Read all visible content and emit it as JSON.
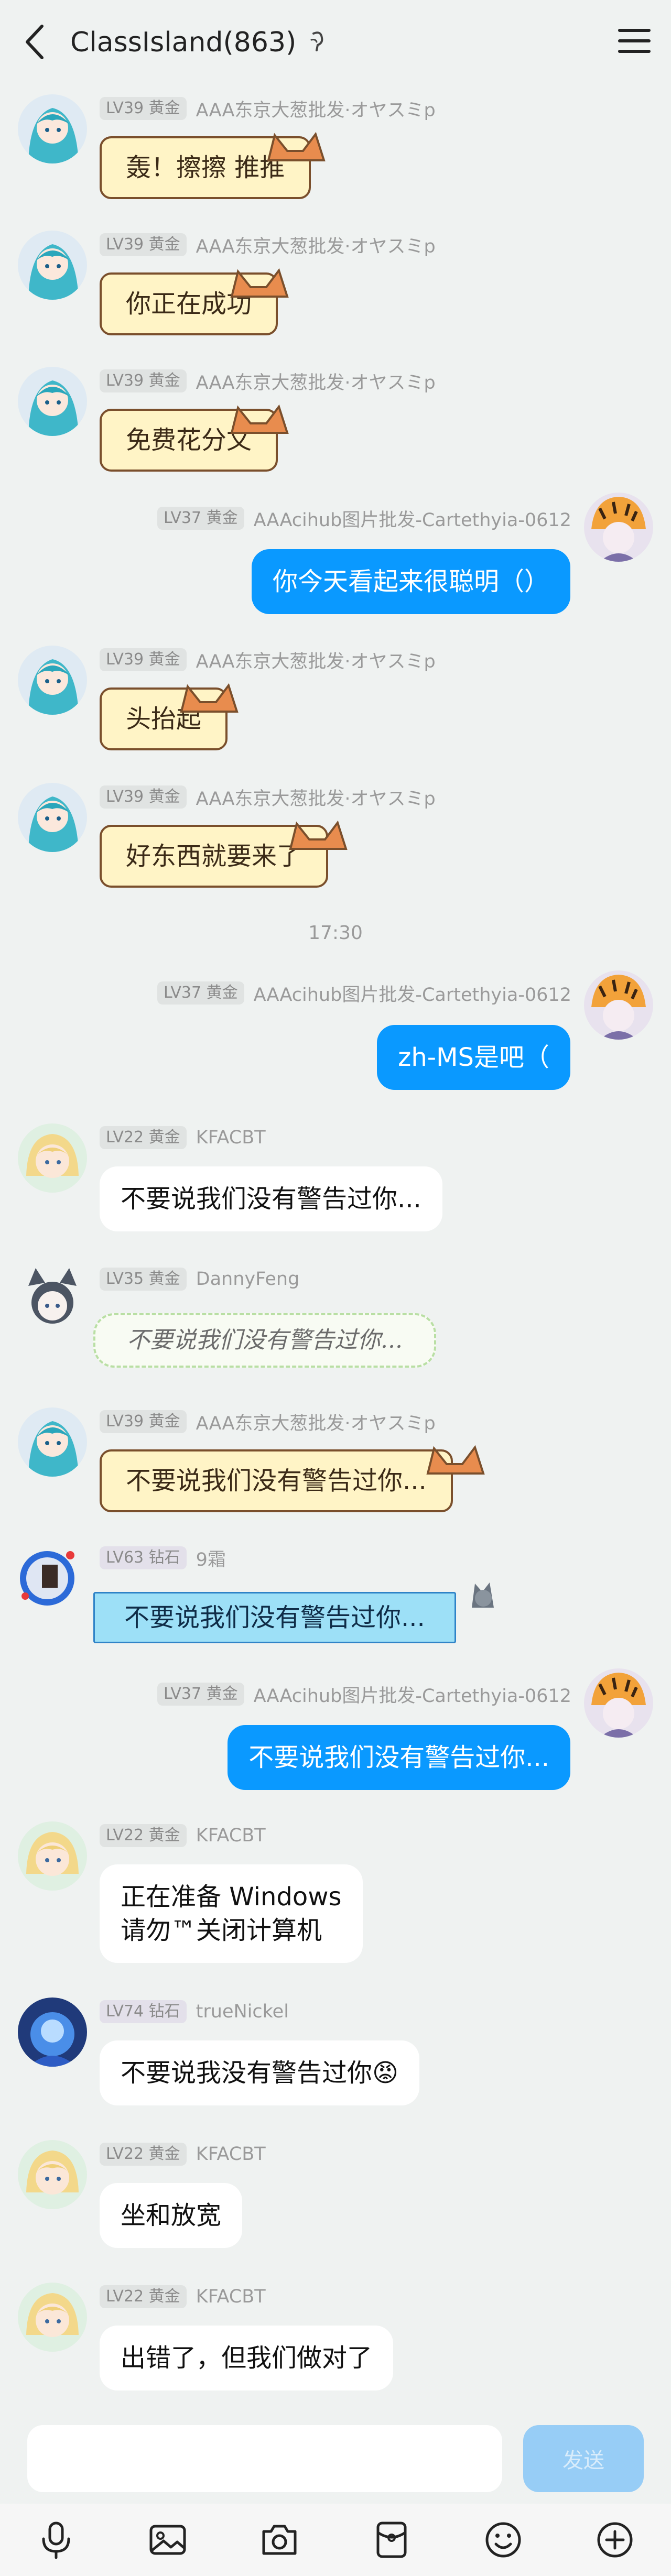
{
  "header": {
    "title": "ClassIsland(863)"
  },
  "messages": [
    {
      "id": "m1",
      "side": "left",
      "level": "LV39 黄金",
      "name": "AAA东京大葱批发·オヤスミp",
      "text": "轰！擦擦 推推",
      "style": "cat"
    },
    {
      "id": "m2",
      "side": "left",
      "level": "LV39 黄金",
      "name": "AAA东京大葱批发·オヤスミp",
      "text": "你正在成功",
      "style": "cat"
    },
    {
      "id": "m3",
      "side": "left",
      "level": "LV39 黄金",
      "name": "AAA东京大葱批发·オヤスミp",
      "text": "免费花分文",
      "style": "cat"
    },
    {
      "id": "m4",
      "side": "right",
      "level": "LV37 黄金",
      "name": "AAAcihub图片批发-Cartethyia-0612",
      "text": "你今天看起来很聪明（）",
      "style": "blue"
    },
    {
      "id": "m5",
      "side": "left",
      "level": "LV39 黄金",
      "name": "AAA东京大葱批发·オヤスミp",
      "text": "头抬起",
      "style": "cat"
    },
    {
      "id": "m6",
      "side": "left",
      "level": "LV39 黄金",
      "name": "AAA东京大葱批发·オヤスミp",
      "text": "好东西就要来了",
      "style": "cat"
    },
    {
      "id": "m7",
      "side": "right",
      "level": "LV37 黄金",
      "name": "AAAcihub图片批发-Cartethyia-0612",
      "text": "zh-MS是吧（",
      "style": "blue"
    },
    {
      "id": "m8",
      "side": "left",
      "level": "LV22 黄金",
      "name": "KFACBT",
      "text": "不要说我们没有警告过你...",
      "style": "white"
    },
    {
      "id": "m9",
      "side": "left",
      "level": "LV35 黄金",
      "name": "DannyFeng",
      "text": "不要说我们没有警告过你...",
      "style": "hand"
    },
    {
      "id": "m10",
      "side": "left",
      "level": "LV39 黄金",
      "name": "AAA东京大葱批发·オヤスミp",
      "text": "不要说我们没有警告过你...",
      "style": "cat"
    },
    {
      "id": "m11",
      "side": "left",
      "level": "LV63 钻石",
      "name": "9霜",
      "text": "不要说我们没有警告过你...",
      "style": "sky"
    },
    {
      "id": "m12",
      "side": "right",
      "level": "LV37 黄金",
      "name": "AAAcihub图片批发-Cartethyia-0612",
      "text": "不要说我们没有警告过你...",
      "style": "blue"
    },
    {
      "id": "m13",
      "side": "left",
      "level": "LV22 黄金",
      "name": "KFACBT",
      "text": "正在准备 Windows\n请勿™关闭计算机",
      "style": "white"
    },
    {
      "id": "m14",
      "side": "left",
      "level": "LV74 钻石",
      "name": "trueNickel",
      "text": "不要说我没有警告过你😡",
      "style": "white"
    },
    {
      "id": "m15",
      "side": "left",
      "level": "LV22 黄金",
      "name": "KFACBT",
      "text": "坐和放宽",
      "style": "white"
    },
    {
      "id": "m16",
      "side": "left",
      "level": "LV22 黄金",
      "name": "KFACBT",
      "text": "出错了，但我们做对了",
      "style": "white"
    }
  ],
  "timestamp": "17:30",
  "input": {
    "send_label": "发送"
  },
  "toolbar": [
    "microphone-icon",
    "image-icon",
    "camera-icon",
    "red-packet-icon",
    "emoji-icon",
    "plus-icon"
  ]
}
